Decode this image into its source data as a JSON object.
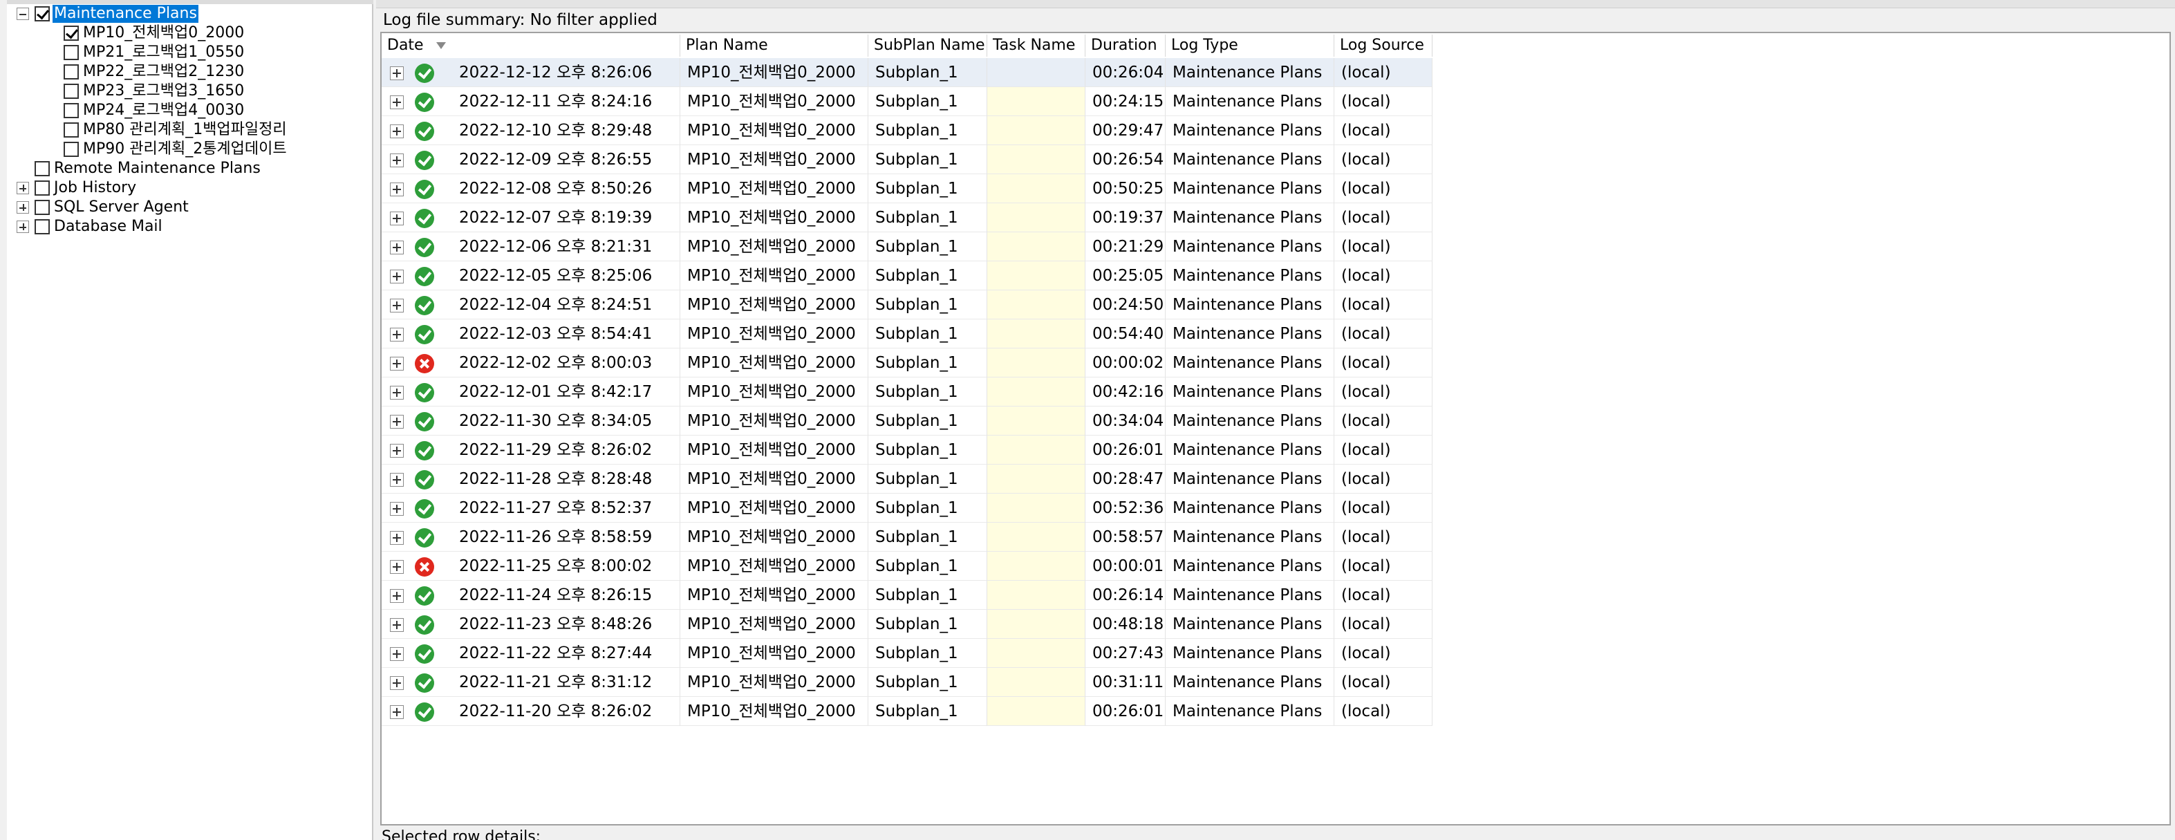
{
  "tree": {
    "root": {
      "label": "Maintenance Plans",
      "checked": true
    },
    "plans": [
      {
        "label": "MP10_전체백업0_2000",
        "checked": true
      },
      {
        "label": "MP21_로그백업1_0550",
        "checked": false
      },
      {
        "label": "MP22_로그백업2_1230",
        "checked": false
      },
      {
        "label": "MP23_로그백업3_1650",
        "checked": false
      },
      {
        "label": "MP24_로그백업4_0030",
        "checked": false
      },
      {
        "label": "MP80 관리계획_1백업파일정리",
        "checked": false
      },
      {
        "label": "MP90 관리계획_2통계업데이트",
        "checked": false
      }
    ],
    "remote": {
      "label": "Remote Maintenance Plans"
    },
    "job_history": {
      "label": "Job History"
    },
    "sql_agent": {
      "label": "SQL Server Agent"
    },
    "db_mail": {
      "label": "Database Mail"
    }
  },
  "summary": "Log file summary: No filter applied",
  "columns": {
    "date": "Date",
    "plan": "Plan Name",
    "subplan": "SubPlan Name",
    "task": "Task Name",
    "duration": "Duration",
    "log_type": "Log Type",
    "log_source": "Log Source"
  },
  "rows": [
    {
      "status": "success",
      "date": "2022-12-12 오후 8:26:06",
      "plan": "MP10_전체백업0_2000",
      "subplan": "Subplan_1",
      "task": "",
      "duration": "00:26:04",
      "log_type": "Maintenance Plans",
      "log_source": "(local)"
    },
    {
      "status": "success",
      "date": "2022-12-11 오후 8:24:16",
      "plan": "MP10_전체백업0_2000",
      "subplan": "Subplan_1",
      "task": "",
      "duration": "00:24:15",
      "log_type": "Maintenance Plans",
      "log_source": "(local)"
    },
    {
      "status": "success",
      "date": "2022-12-10 오후 8:29:48",
      "plan": "MP10_전체백업0_2000",
      "subplan": "Subplan_1",
      "task": "",
      "duration": "00:29:47",
      "log_type": "Maintenance Plans",
      "log_source": "(local)"
    },
    {
      "status": "success",
      "date": "2022-12-09 오후 8:26:55",
      "plan": "MP10_전체백업0_2000",
      "subplan": "Subplan_1",
      "task": "",
      "duration": "00:26:54",
      "log_type": "Maintenance Plans",
      "log_source": "(local)"
    },
    {
      "status": "success",
      "date": "2022-12-08 오후 8:50:26",
      "plan": "MP10_전체백업0_2000",
      "subplan": "Subplan_1",
      "task": "",
      "duration": "00:50:25",
      "log_type": "Maintenance Plans",
      "log_source": "(local)"
    },
    {
      "status": "success",
      "date": "2022-12-07 오후 8:19:39",
      "plan": "MP10_전체백업0_2000",
      "subplan": "Subplan_1",
      "task": "",
      "duration": "00:19:37",
      "log_type": "Maintenance Plans",
      "log_source": "(local)"
    },
    {
      "status": "success",
      "date": "2022-12-06 오후 8:21:31",
      "plan": "MP10_전체백업0_2000",
      "subplan": "Subplan_1",
      "task": "",
      "duration": "00:21:29",
      "log_type": "Maintenance Plans",
      "log_source": "(local)"
    },
    {
      "status": "success",
      "date": "2022-12-05 오후 8:25:06",
      "plan": "MP10_전체백업0_2000",
      "subplan": "Subplan_1",
      "task": "",
      "duration": "00:25:05",
      "log_type": "Maintenance Plans",
      "log_source": "(local)"
    },
    {
      "status": "success",
      "date": "2022-12-04 오후 8:24:51",
      "plan": "MP10_전체백업0_2000",
      "subplan": "Subplan_1",
      "task": "",
      "duration": "00:24:50",
      "log_type": "Maintenance Plans",
      "log_source": "(local)"
    },
    {
      "status": "success",
      "date": "2022-12-03 오후 8:54:41",
      "plan": "MP10_전체백업0_2000",
      "subplan": "Subplan_1",
      "task": "",
      "duration": "00:54:40",
      "log_type": "Maintenance Plans",
      "log_source": "(local)"
    },
    {
      "status": "failure",
      "date": "2022-12-02 오후 8:00:03",
      "plan": "MP10_전체백업0_2000",
      "subplan": "Subplan_1",
      "task": "",
      "duration": "00:00:02",
      "log_type": "Maintenance Plans",
      "log_source": "(local)"
    },
    {
      "status": "success",
      "date": "2022-12-01 오후 8:42:17",
      "plan": "MP10_전체백업0_2000",
      "subplan": "Subplan_1",
      "task": "",
      "duration": "00:42:16",
      "log_type": "Maintenance Plans",
      "log_source": "(local)"
    },
    {
      "status": "success",
      "date": "2022-11-30 오후 8:34:05",
      "plan": "MP10_전체백업0_2000",
      "subplan": "Subplan_1",
      "task": "",
      "duration": "00:34:04",
      "log_type": "Maintenance Plans",
      "log_source": "(local)"
    },
    {
      "status": "success",
      "date": "2022-11-29 오후 8:26:02",
      "plan": "MP10_전체백업0_2000",
      "subplan": "Subplan_1",
      "task": "",
      "duration": "00:26:01",
      "log_type": "Maintenance Plans",
      "log_source": "(local)"
    },
    {
      "status": "success",
      "date": "2022-11-28 오후 8:28:48",
      "plan": "MP10_전체백업0_2000",
      "subplan": "Subplan_1",
      "task": "",
      "duration": "00:28:47",
      "log_type": "Maintenance Plans",
      "log_source": "(local)"
    },
    {
      "status": "success",
      "date": "2022-11-27 오후 8:52:37",
      "plan": "MP10_전체백업0_2000",
      "subplan": "Subplan_1",
      "task": "",
      "duration": "00:52:36",
      "log_type": "Maintenance Plans",
      "log_source": "(local)"
    },
    {
      "status": "success",
      "date": "2022-11-26 오후 8:58:59",
      "plan": "MP10_전체백업0_2000",
      "subplan": "Subplan_1",
      "task": "",
      "duration": "00:58:57",
      "log_type": "Maintenance Plans",
      "log_source": "(local)"
    },
    {
      "status": "failure",
      "date": "2022-11-25 오후 8:00:02",
      "plan": "MP10_전체백업0_2000",
      "subplan": "Subplan_1",
      "task": "",
      "duration": "00:00:01",
      "log_type": "Maintenance Plans",
      "log_source": "(local)"
    },
    {
      "status": "success",
      "date": "2022-11-24 오후 8:26:15",
      "plan": "MP10_전체백업0_2000",
      "subplan": "Subplan_1",
      "task": "",
      "duration": "00:26:14",
      "log_type": "Maintenance Plans",
      "log_source": "(local)"
    },
    {
      "status": "success",
      "date": "2022-11-23 오후 8:48:26",
      "plan": "MP10_전체백업0_2000",
      "subplan": "Subplan_1",
      "task": "",
      "duration": "00:48:18",
      "log_type": "Maintenance Plans",
      "log_source": "(local)"
    },
    {
      "status": "success",
      "date": "2022-11-22 오후 8:27:44",
      "plan": "MP10_전체백업0_2000",
      "subplan": "Subplan_1",
      "task": "",
      "duration": "00:27:43",
      "log_type": "Maintenance Plans",
      "log_source": "(local)"
    },
    {
      "status": "success",
      "date": "2022-11-21 오후 8:31:12",
      "plan": "MP10_전체백업0_2000",
      "subplan": "Subplan_1",
      "task": "",
      "duration": "00:31:11",
      "log_type": "Maintenance Plans",
      "log_source": "(local)"
    },
    {
      "status": "success",
      "date": "2022-11-20 오후 8:26:02",
      "plan": "MP10_전체백업0_2000",
      "subplan": "Subplan_1",
      "task": "",
      "duration": "00:26:01",
      "log_type": "Maintenance Plans",
      "log_source": "(local)"
    }
  ],
  "selected_row_details": "Selected row details:"
}
